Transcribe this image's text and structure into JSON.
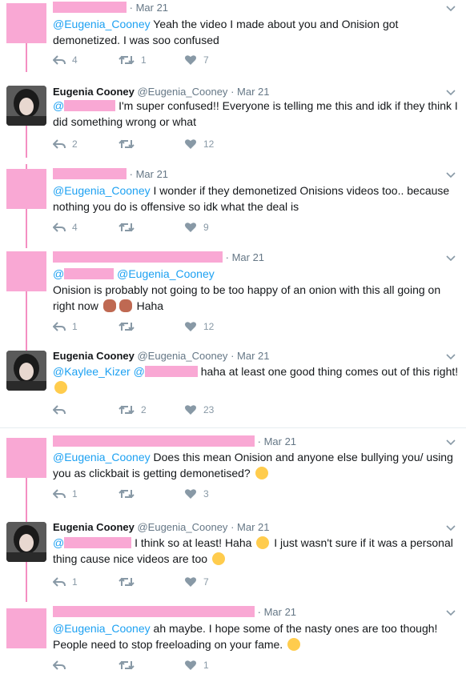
{
  "tweets": [
    {
      "date": "Mar 21",
      "parts": [
        "Yeah the video I made about you and Onision got demonetized. I was soo confused"
      ],
      "mention": "@Eugenia_Cooney",
      "reply": "4",
      "retweet": "1",
      "like": "7"
    },
    {
      "name": "Eugenia Cooney",
      "handle": "@Eugenia_Cooney",
      "date": "Mar 21",
      "mention": "@",
      "text": "I'm super confused!! Everyone is telling me this and idk if they think I did something wrong or what",
      "reply": "2",
      "retweet": "",
      "like": "12"
    },
    {
      "date": "Mar 21",
      "mention": "@Eugenia_Cooney",
      "text": "I wonder if they demonetized Onisions videos too.. because nothing you do is offensive so idk what the deal is",
      "reply": "4",
      "retweet": "",
      "like": "9"
    },
    {
      "date": "Mar 21",
      "mention1": "@",
      "mention2": "@Eugenia_Cooney",
      "text": "Onision is probably not going to be too happy of an onion with this all going on right now",
      "text_after": "Haha",
      "reply": "1",
      "retweet": "",
      "like": "12"
    },
    {
      "name": "Eugenia Cooney",
      "handle": "@Eugenia_Cooney",
      "date": "Mar 21",
      "mention1": "@Kaylee_Kizer",
      "mention2": "@",
      "text": "haha at least one good thing comes out of this right!",
      "reply": "",
      "retweet": "2",
      "like": "23"
    },
    {
      "date": "Mar 21",
      "mention": "@Eugenia_Cooney",
      "text": "Does this mean Onision and anyone else bullying you/ using you as clickbait is getting demonetised?",
      "reply": "1",
      "retweet": "",
      "like": "3"
    },
    {
      "name": "Eugenia Cooney",
      "handle": "@Eugenia_Cooney",
      "date": "Mar 21",
      "mention": "@",
      "text1": "I think so at least! Haha",
      "text2": "I just wasn't sure if it was a personal thing cause nice videos are too",
      "reply": "1",
      "retweet": "",
      "like": "7"
    },
    {
      "date": "Mar 21",
      "mention": "@Eugenia_Cooney",
      "text": "ah maybe. I hope some of the nasty ones are too though! People need to stop freeloading on your fame.",
      "reply": "",
      "retweet": "",
      "like": "1"
    }
  ],
  "icons": [
    "reply-icon",
    "retweet-icon",
    "like-icon",
    "caret-down-icon"
  ],
  "colors": {
    "mention": "#1da1f2",
    "redaction": "#f9a8d4",
    "thread": "#f48fc2",
    "muted": "#8899a6"
  }
}
